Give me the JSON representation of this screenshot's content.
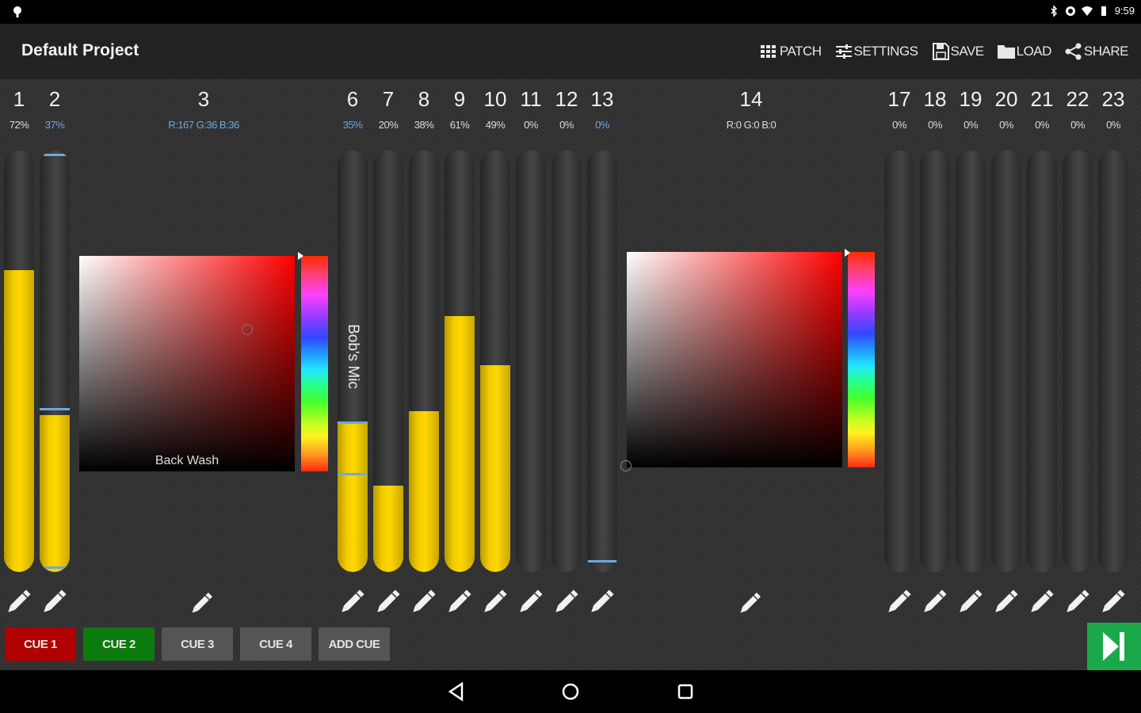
{
  "status_bar": {
    "time": "9:59",
    "icons": [
      "notification-icon",
      "bluetooth-icon",
      "sync-icon",
      "wifi-icon",
      "battery-icon"
    ]
  },
  "action_bar": {
    "title": "Default Project",
    "actions": [
      {
        "label": "PATCH",
        "icon": "grid-icon"
      },
      {
        "label": "SETTINGS",
        "icon": "sliders-icon"
      },
      {
        "label": "SAVE",
        "icon": "save-icon"
      },
      {
        "label": "LOAD",
        "icon": "folder-icon"
      },
      {
        "label": "SHARE",
        "icon": "share-icon"
      }
    ]
  },
  "channels": [
    {
      "number": "1",
      "value": "72%",
      "level": 0.72,
      "value_color": "white"
    },
    {
      "number": "2",
      "value": "37%",
      "level": 0.37,
      "value_color": "blue"
    },
    {
      "number": "6",
      "value": "35%",
      "level": 0.35,
      "value_color": "blue",
      "name": "Bob's Mic"
    },
    {
      "number": "7",
      "value": "20%",
      "level": 0.2,
      "value_color": "white"
    },
    {
      "number": "8",
      "value": "38%",
      "level": 0.38,
      "value_color": "white"
    },
    {
      "number": "9",
      "value": "61%",
      "level": 0.61,
      "value_color": "white"
    },
    {
      "number": "10",
      "value": "49%",
      "level": 0.49,
      "value_color": "white"
    },
    {
      "number": "11",
      "value": "0%",
      "level": 0,
      "value_color": "white"
    },
    {
      "number": "12",
      "value": "0%",
      "level": 0,
      "value_color": "white"
    },
    {
      "number": "13",
      "value": "0%",
      "level": 0,
      "value_color": "blue"
    },
    {
      "number": "17",
      "value": "0%",
      "level": 0,
      "value_color": "white"
    },
    {
      "number": "18",
      "value": "0%",
      "level": 0,
      "value_color": "white"
    },
    {
      "number": "19",
      "value": "0%",
      "level": 0,
      "value_color": "white"
    },
    {
      "number": "20",
      "value": "0%",
      "level": 0,
      "value_color": "white"
    },
    {
      "number": "21",
      "value": "0%",
      "level": 0,
      "value_color": "white"
    },
    {
      "number": "22",
      "value": "0%",
      "level": 0,
      "value_color": "white"
    },
    {
      "number": "23",
      "value": "0%",
      "level": 0,
      "value_color": "white"
    }
  ],
  "color_fixtures": [
    {
      "number": "3",
      "value": "R:167 G:36 B:36",
      "value_color": "blue",
      "name": "Back Wash",
      "hue_color": "#ff0000"
    },
    {
      "number": "14",
      "value": "R:0 G:0 B:0",
      "value_color": "white",
      "name": "",
      "hue_color": "#ff0000"
    }
  ],
  "cues": [
    {
      "label": "CUE 1",
      "color": "red"
    },
    {
      "label": "CUE 2",
      "color": "green"
    },
    {
      "label": "CUE 3",
      "color": "gray"
    },
    {
      "label": "CUE 4",
      "color": "gray"
    },
    {
      "label": "ADD CUE",
      "color": "gray"
    }
  ],
  "go_button": {
    "icon": "skip-next-icon",
    "color": "#1ba84a"
  },
  "nav_bar": {
    "icons": [
      "back-icon",
      "home-icon",
      "recents-icon"
    ]
  },
  "colors": {
    "fader_fill": "#ffd700",
    "fader_cap": "#6fa8dc",
    "value_blue": "#6fa8dc"
  }
}
